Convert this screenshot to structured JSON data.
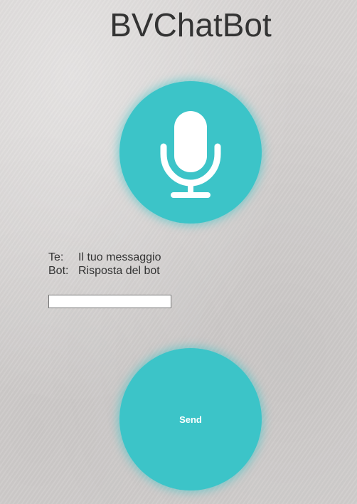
{
  "app": {
    "title": "BVChatBot"
  },
  "mic": {
    "icon": "microphone-icon",
    "color": "#3cc4c8"
  },
  "chat": {
    "user_label": "Te:",
    "user_message": "Il tuo messaggio",
    "bot_label": "Bot:",
    "bot_message": "Risposta del bot"
  },
  "input": {
    "value": "",
    "placeholder": ""
  },
  "send": {
    "label": "Send"
  },
  "colors": {
    "accent": "#3cc4c8",
    "text": "#333333",
    "background": "#d6d3d2"
  }
}
